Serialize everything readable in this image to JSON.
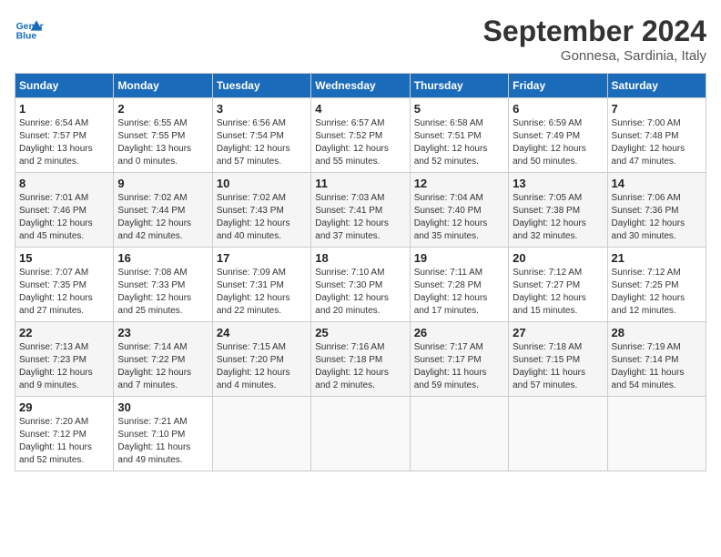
{
  "header": {
    "logo_line1": "General",
    "logo_line2": "Blue",
    "month": "September 2024",
    "location": "Gonnesa, Sardinia, Italy"
  },
  "days_of_week": [
    "Sunday",
    "Monday",
    "Tuesday",
    "Wednesday",
    "Thursday",
    "Friday",
    "Saturday"
  ],
  "weeks": [
    [
      {
        "num": "1",
        "info": "Sunrise: 6:54 AM\nSunset: 7:57 PM\nDaylight: 13 hours\nand 2 minutes."
      },
      {
        "num": "2",
        "info": "Sunrise: 6:55 AM\nSunset: 7:55 PM\nDaylight: 13 hours\nand 0 minutes."
      },
      {
        "num": "3",
        "info": "Sunrise: 6:56 AM\nSunset: 7:54 PM\nDaylight: 12 hours\nand 57 minutes."
      },
      {
        "num": "4",
        "info": "Sunrise: 6:57 AM\nSunset: 7:52 PM\nDaylight: 12 hours\nand 55 minutes."
      },
      {
        "num": "5",
        "info": "Sunrise: 6:58 AM\nSunset: 7:51 PM\nDaylight: 12 hours\nand 52 minutes."
      },
      {
        "num": "6",
        "info": "Sunrise: 6:59 AM\nSunset: 7:49 PM\nDaylight: 12 hours\nand 50 minutes."
      },
      {
        "num": "7",
        "info": "Sunrise: 7:00 AM\nSunset: 7:48 PM\nDaylight: 12 hours\nand 47 minutes."
      }
    ],
    [
      {
        "num": "8",
        "info": "Sunrise: 7:01 AM\nSunset: 7:46 PM\nDaylight: 12 hours\nand 45 minutes."
      },
      {
        "num": "9",
        "info": "Sunrise: 7:02 AM\nSunset: 7:44 PM\nDaylight: 12 hours\nand 42 minutes."
      },
      {
        "num": "10",
        "info": "Sunrise: 7:02 AM\nSunset: 7:43 PM\nDaylight: 12 hours\nand 40 minutes."
      },
      {
        "num": "11",
        "info": "Sunrise: 7:03 AM\nSunset: 7:41 PM\nDaylight: 12 hours\nand 37 minutes."
      },
      {
        "num": "12",
        "info": "Sunrise: 7:04 AM\nSunset: 7:40 PM\nDaylight: 12 hours\nand 35 minutes."
      },
      {
        "num": "13",
        "info": "Sunrise: 7:05 AM\nSunset: 7:38 PM\nDaylight: 12 hours\nand 32 minutes."
      },
      {
        "num": "14",
        "info": "Sunrise: 7:06 AM\nSunset: 7:36 PM\nDaylight: 12 hours\nand 30 minutes."
      }
    ],
    [
      {
        "num": "15",
        "info": "Sunrise: 7:07 AM\nSunset: 7:35 PM\nDaylight: 12 hours\nand 27 minutes."
      },
      {
        "num": "16",
        "info": "Sunrise: 7:08 AM\nSunset: 7:33 PM\nDaylight: 12 hours\nand 25 minutes."
      },
      {
        "num": "17",
        "info": "Sunrise: 7:09 AM\nSunset: 7:31 PM\nDaylight: 12 hours\nand 22 minutes."
      },
      {
        "num": "18",
        "info": "Sunrise: 7:10 AM\nSunset: 7:30 PM\nDaylight: 12 hours\nand 20 minutes."
      },
      {
        "num": "19",
        "info": "Sunrise: 7:11 AM\nSunset: 7:28 PM\nDaylight: 12 hours\nand 17 minutes."
      },
      {
        "num": "20",
        "info": "Sunrise: 7:12 AM\nSunset: 7:27 PM\nDaylight: 12 hours\nand 15 minutes."
      },
      {
        "num": "21",
        "info": "Sunrise: 7:12 AM\nSunset: 7:25 PM\nDaylight: 12 hours\nand 12 minutes."
      }
    ],
    [
      {
        "num": "22",
        "info": "Sunrise: 7:13 AM\nSunset: 7:23 PM\nDaylight: 12 hours\nand 9 minutes."
      },
      {
        "num": "23",
        "info": "Sunrise: 7:14 AM\nSunset: 7:22 PM\nDaylight: 12 hours\nand 7 minutes."
      },
      {
        "num": "24",
        "info": "Sunrise: 7:15 AM\nSunset: 7:20 PM\nDaylight: 12 hours\nand 4 minutes."
      },
      {
        "num": "25",
        "info": "Sunrise: 7:16 AM\nSunset: 7:18 PM\nDaylight: 12 hours\nand 2 minutes."
      },
      {
        "num": "26",
        "info": "Sunrise: 7:17 AM\nSunset: 7:17 PM\nDaylight: 11 hours\nand 59 minutes."
      },
      {
        "num": "27",
        "info": "Sunrise: 7:18 AM\nSunset: 7:15 PM\nDaylight: 11 hours\nand 57 minutes."
      },
      {
        "num": "28",
        "info": "Sunrise: 7:19 AM\nSunset: 7:14 PM\nDaylight: 11 hours\nand 54 minutes."
      }
    ],
    [
      {
        "num": "29",
        "info": "Sunrise: 7:20 AM\nSunset: 7:12 PM\nDaylight: 11 hours\nand 52 minutes."
      },
      {
        "num": "30",
        "info": "Sunrise: 7:21 AM\nSunset: 7:10 PM\nDaylight: 11 hours\nand 49 minutes."
      },
      {
        "num": "",
        "info": ""
      },
      {
        "num": "",
        "info": ""
      },
      {
        "num": "",
        "info": ""
      },
      {
        "num": "",
        "info": ""
      },
      {
        "num": "",
        "info": ""
      }
    ]
  ]
}
